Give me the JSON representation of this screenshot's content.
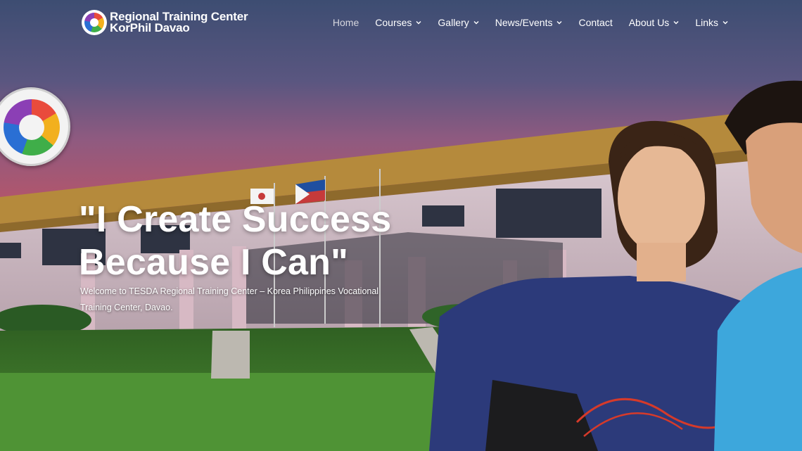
{
  "site": {
    "logo_line1": "Regional Training Center",
    "logo_line2": "KorPhil Davao"
  },
  "nav": {
    "items": [
      {
        "label": "Home",
        "dropdown": false,
        "active": true
      },
      {
        "label": "Courses",
        "dropdown": true
      },
      {
        "label": "Gallery",
        "dropdown": true
      },
      {
        "label": "News/Events",
        "dropdown": true
      },
      {
        "label": "Contact",
        "dropdown": false
      },
      {
        "label": "About Us",
        "dropdown": true
      },
      {
        "label": "Links",
        "dropdown": true
      }
    ]
  },
  "hero": {
    "headline": "\"I Create Success\nBecause I Can\"",
    "subtext": "Welcome to TESDA Regional Training Center – Korea Philippines Vocational Training Center, Davao."
  },
  "colors": {
    "sky_top": "#3d4d72",
    "sky_mid": "#7a5a84",
    "sky_low": "#b0566d",
    "roof": "#b58a3c",
    "grass": "#3f7a2a",
    "uniform_blue": "#2c3a7a",
    "shirt_blue": "#3da7dc"
  }
}
